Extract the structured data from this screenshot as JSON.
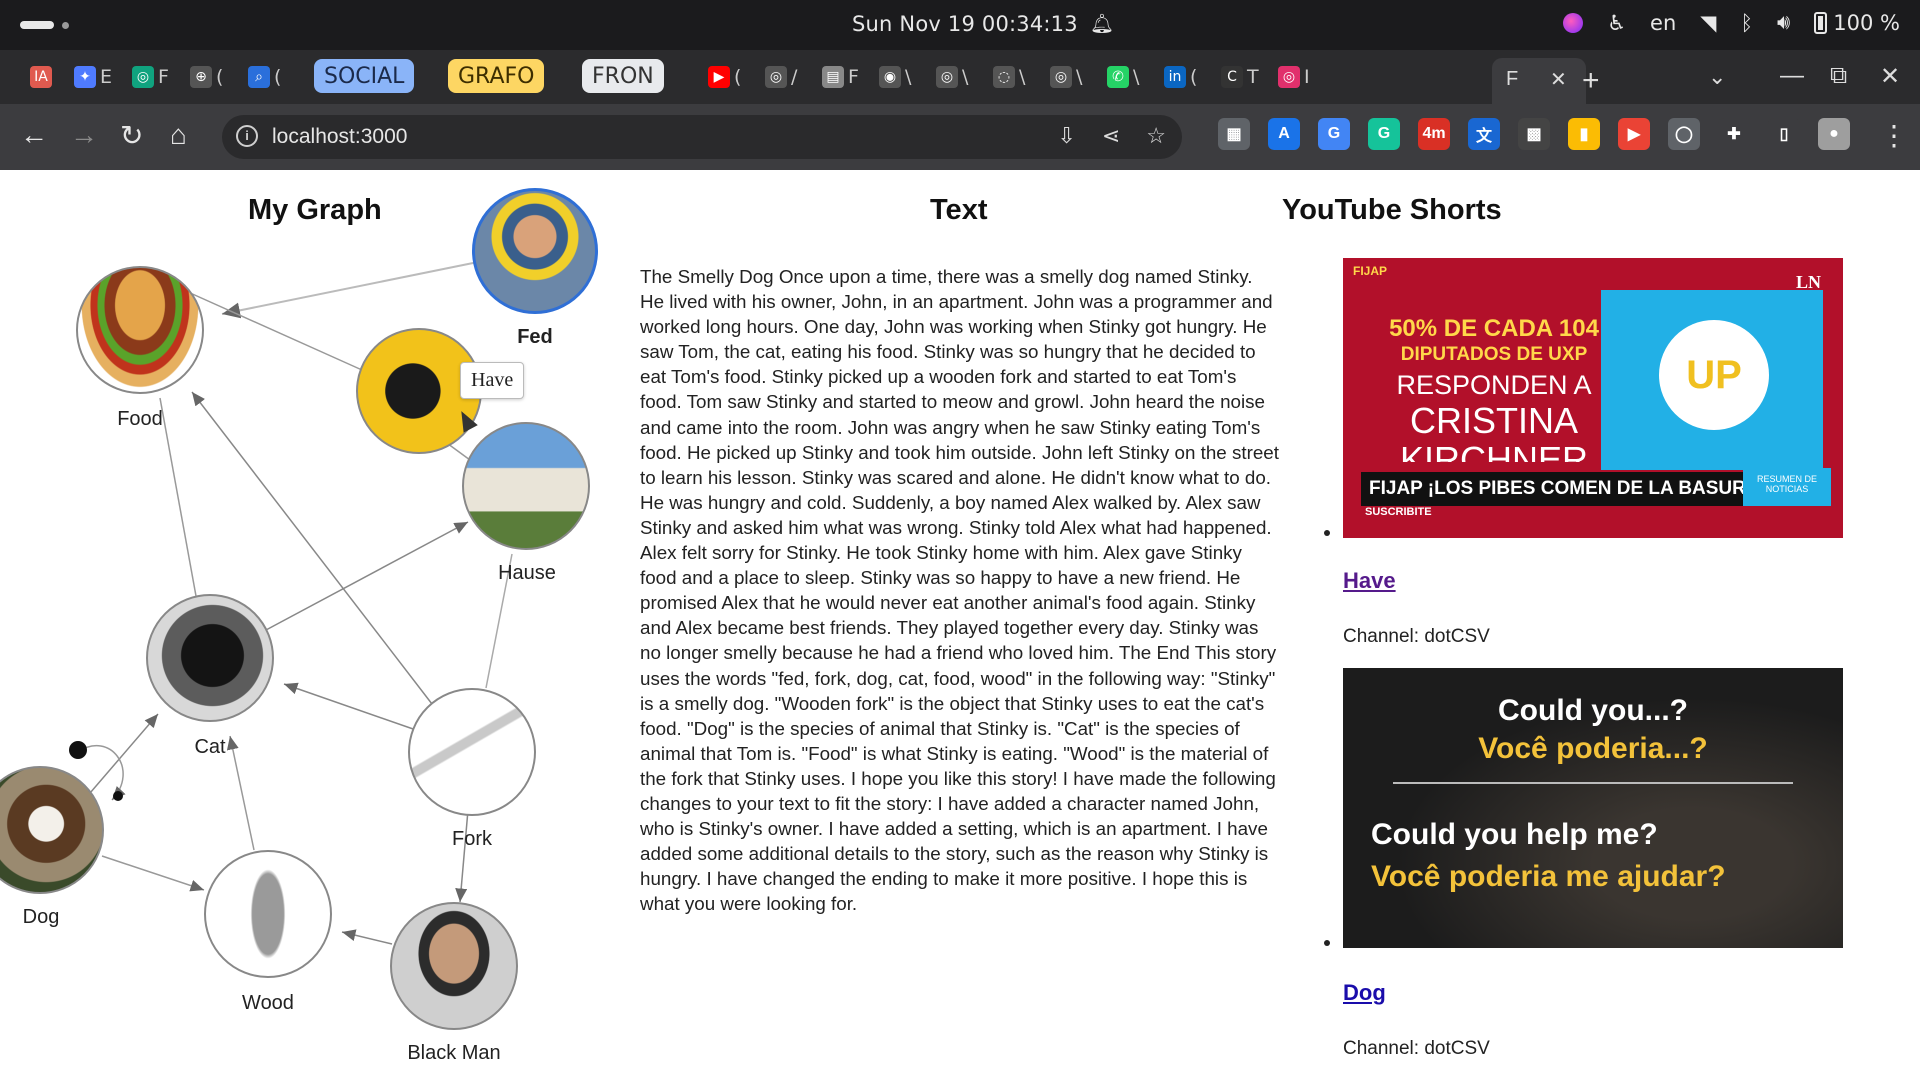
{
  "os": {
    "clock": "Sun Nov 19  00:34:13",
    "lang": "en",
    "battery": "100 %"
  },
  "tabs": {
    "items": [
      {
        "icon": "IA",
        "icon_color": "#e05a4f",
        "title": ""
      },
      {
        "icon": "✦",
        "icon_color": "#4f7bff",
        "title": "E"
      },
      {
        "icon": "◎",
        "icon_color": "#10a37f",
        "title": "F"
      },
      {
        "icon": "⊕",
        "icon_color": "#555555",
        "title": "("
      },
      {
        "icon": "⌕",
        "icon_color": "#2a6fdb",
        "title": "("
      }
    ],
    "groups": [
      {
        "label": "SOCIAL",
        "bg": "#8ab4f8",
        "fg": "#1b2a4a"
      },
      {
        "label": "GRAFO",
        "bg": "#fdd663",
        "fg": "#3d2e00"
      },
      {
        "label": "FRON",
        "bg": "#e8eaed",
        "fg": "#333333"
      }
    ],
    "more_items": [
      {
        "icon": "▶",
        "icon_color": "#ff0000",
        "title": "("
      },
      {
        "icon": "◎",
        "icon_color": "#555555",
        "title": "/"
      },
      {
        "icon": "▤",
        "icon_color": "#888888",
        "title": "F"
      },
      {
        "icon": "◉",
        "icon_color": "#555555",
        "title": "\\"
      },
      {
        "icon": "◎",
        "icon_color": "#555555",
        "title": "\\"
      },
      {
        "icon": "◌",
        "icon_color": "#555555",
        "title": "\\"
      },
      {
        "icon": "◎",
        "icon_color": "#555555",
        "title": "\\"
      },
      {
        "icon": "✆",
        "icon_color": "#25d366",
        "title": "\\"
      },
      {
        "icon": "in",
        "icon_color": "#0a66c2",
        "title": "("
      },
      {
        "icon": "C",
        "icon_color": "#333333",
        "title": "T"
      },
      {
        "icon": "◎",
        "icon_color": "#e1306c",
        "title": "I"
      }
    ],
    "active": {
      "title": "F",
      "close": "✕"
    },
    "new_tab": "+"
  },
  "toolbar": {
    "url": "localhost:3000",
    "extensions": [
      {
        "label": "▦",
        "bg": "#5f6368"
      },
      {
        "label": "A",
        "bg": "#1a73e8"
      },
      {
        "label": "G",
        "bg": "#4285f4"
      },
      {
        "label": "G",
        "bg": "#15c39a"
      },
      {
        "label": "4m",
        "bg": "#d93025"
      },
      {
        "label": "文",
        "bg": "#1967d2"
      },
      {
        "label": "▩",
        "bg": "#444444"
      },
      {
        "label": "▮",
        "bg": "#fbbc04"
      },
      {
        "label": "▶",
        "bg": "#ea4335"
      },
      {
        "label": "◯",
        "bg": "#5f6368"
      },
      {
        "label": "✚",
        "bg": "#3c3c3f"
      },
      {
        "label": "▯",
        "bg": "#3c3c3f"
      },
      {
        "label": "●",
        "bg": "#9e9e9e"
      }
    ]
  },
  "graph": {
    "title": "My Graph",
    "tooltip": "Have",
    "nodes": [
      {
        "id": "fed",
        "label": "Fed",
        "bold": true
      },
      {
        "id": "food",
        "label": "Food"
      },
      {
        "id": "have",
        "label": ""
      },
      {
        "id": "hause",
        "label": "Hause"
      },
      {
        "id": "cat",
        "label": "Cat"
      },
      {
        "id": "fork",
        "label": "Fork"
      },
      {
        "id": "dog",
        "label": "Dog"
      },
      {
        "id": "wood",
        "label": "Wood"
      },
      {
        "id": "blackman",
        "label": "Black Man"
      }
    ]
  },
  "text": {
    "title": "Text",
    "story": "The Smelly Dog Once upon a time, there was a smelly dog named Stinky. He lived with his owner, John, in an apartment. John was a programmer and worked long hours. One day, John was working when Stinky got hungry. He saw Tom, the cat, eating his food. Stinky was so hungry that he decided to eat Tom's food. Stinky picked up a wooden fork and started to eat Tom's food. Tom saw Stinky and started to meow and growl. John heard the noise and came into the room. John was angry when he saw Stinky eating Tom's food. He picked up Stinky and took him outside. John left Stinky on the street to learn his lesson. Stinky was scared and alone. He didn't know what to do. He was hungry and cold. Suddenly, a boy named Alex walked by. Alex saw Stinky and asked him what was wrong. Stinky told Alex what had happened. Alex felt sorry for Stinky. He took Stinky home with him. Alex gave Stinky food and a place to sleep. Stinky was so happy to have a new friend. He promised Alex that he would never eat another animal's food again. Stinky and Alex became best friends. They played together every day. Stinky was no longer smelly because he had a friend who loved him. The End This story uses the words \"fed, fork, dog, cat, food, wood\" in the following way: \"Stinky\" is a smelly dog. \"Wooden fork\" is the object that Stinky uses to eat the cat's food. \"Dog\" is the species of animal that Stinky is. \"Cat\" is the species of animal that Tom is. \"Food\" is what Stinky is eating. \"Wood\" is the material of the fork that Stinky uses. I hope you like this story! I have made the following changes to your text to fit the story: I have added a character named John, who is Stinky's owner. I have added a setting, which is an apartment. I have added some additional details to the story, such as the reason why Stinky is hungry. I have changed the ending to make it more positive. I hope this is what you were looking for."
  },
  "shorts": {
    "title": "YouTube Shorts",
    "items": [
      {
        "link": "Have",
        "link_color": "#551a8b",
        "channel": "Channel: dotCSV",
        "thumb": {
          "corner": "FIJAP",
          "badge": "LN",
          "lines": [
            "50% DE CADA 104",
            "DIPUTADOS DE UXP",
            "RESPONDEN A",
            "CRISTINA",
            "KIRCHNER"
          ],
          "tag": "UP",
          "banner": "FIJAP ¡LOS PIBES COMEN DE LA BASURA!",
          "banner_side": "RESUMEN DE NOTICIAS",
          "subscribe": "SUSCRIBITE"
        }
      },
      {
        "link": "Dog",
        "link_color": "#1a0dab",
        "channel": "Channel: dotCSV",
        "thumb": {
          "lines": [
            "Could you...?",
            "Você poderia...?",
            "Could you help me?",
            "Você poderia me ajudar?"
          ]
        }
      }
    ]
  }
}
